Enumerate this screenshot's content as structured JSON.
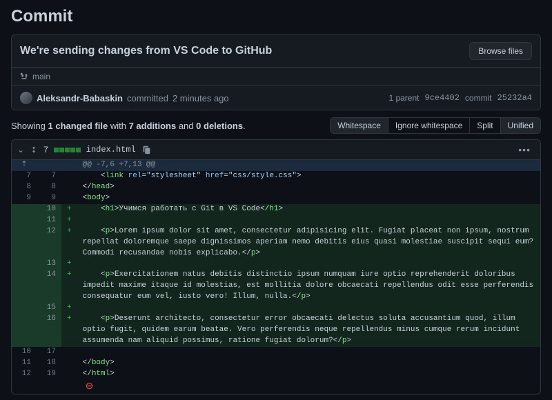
{
  "page": {
    "title": "Commit"
  },
  "commit": {
    "title": "We're sending changes from VS Code to GitHub",
    "browse_btn": "Browse files",
    "branch": "main",
    "author": "Aleksandr-Babaskin",
    "committed_label": "committed",
    "time_ago": "2 minutes ago",
    "parent_label": "1 parent",
    "parent_sha": "9ce4402",
    "commit_label": "commit",
    "commit_sha": "25232a4"
  },
  "summary": {
    "prefix": "Showing",
    "files": "1 changed file",
    "mid": "with",
    "additions": "7 additions",
    "and": "and",
    "deletions": "0 deletions",
    "suffix": "."
  },
  "view": {
    "whitespace": "Whitespace",
    "ignore": "Ignore whitespace",
    "split": "Split",
    "unified": "Unified"
  },
  "diff": {
    "changes_count": "7",
    "filename": "index.html",
    "hunk": "@@ -7,6 +7,13 @@",
    "lines": [
      {
        "type": "ctx",
        "old": "7",
        "new": "7",
        "html": "    <span class='tk-punc'>&lt;</span><span class='tk-tag'>link</span> <span class='tk-attr'>rel</span>=<span class='tk-str'>\"stylesheet\"</span> <span class='tk-attr'>href</span>=<span class='tk-str'>\"css/style.css\"</span><span class='tk-punc'>&gt;</span>"
      },
      {
        "type": "ctx",
        "old": "8",
        "new": "8",
        "html": "<span class='tk-punc'>&lt;/</span><span class='tk-tag'>head</span><span class='tk-punc'>&gt;</span>"
      },
      {
        "type": "ctx",
        "old": "9",
        "new": "9",
        "html": "<span class='tk-punc'>&lt;</span><span class='tk-tag'>body</span><span class='tk-punc'>&gt;</span>"
      },
      {
        "type": "add",
        "old": "",
        "new": "10",
        "html": "    <span class='tk-punc'>&lt;</span><span class='tk-tag'>h1</span><span class='tk-punc'>&gt;</span>Учимся работать с Git в VS Code<span class='tk-punc'>&lt;/</span><span class='tk-tag'>h1</span><span class='tk-punc'>&gt;</span>"
      },
      {
        "type": "add",
        "old": "",
        "new": "11",
        "html": ""
      },
      {
        "type": "add",
        "old": "",
        "new": "12",
        "html": "    <span class='tk-punc'>&lt;</span><span class='tk-tag'>p</span><span class='tk-punc'>&gt;</span>Lorem ipsum dolor sit amet, consectetur adipisicing elit. Fugiat placeat non ipsum, nostrum repellat doloremque saepe dignissimos aperiam nemo debitis eius quasi molestiae suscipit sequi eum? Commodi recusandae nobis explicabo.<span class='tk-punc'>&lt;/</span><span class='tk-tag'>p</span><span class='tk-punc'>&gt;</span>"
      },
      {
        "type": "add",
        "old": "",
        "new": "13",
        "html": ""
      },
      {
        "type": "add",
        "old": "",
        "new": "14",
        "html": "    <span class='tk-punc'>&lt;</span><span class='tk-tag'>p</span><span class='tk-punc'>&gt;</span>Exercitationem natus debitis distinctio ipsum numquam iure optio reprehenderit doloribus impedit maxime itaque id molestias, est mollitia dolore obcaecati repellendus odit esse perferendis consequatur eum vel, iusto vero! Illum, nulla.<span class='tk-punc'>&lt;/</span><span class='tk-tag'>p</span><span class='tk-punc'>&gt;</span>"
      },
      {
        "type": "add",
        "old": "",
        "new": "15",
        "html": ""
      },
      {
        "type": "add",
        "old": "",
        "new": "16",
        "html": "    <span class='tk-punc'>&lt;</span><span class='tk-tag'>p</span><span class='tk-punc'>&gt;</span>Deserunt architecto, consectetur error obcaecati delectus soluta accusantium quod, illum optio fugit, quidem earum beatae. Vero perferendis neque repellendus minus cumque rerum incidunt assumenda nam aliquid possimus, ratione fugiat dolorum?<span class='tk-punc'>&lt;/</span><span class='tk-tag'>p</span><span class='tk-punc'>&gt;</span>"
      },
      {
        "type": "ctx",
        "old": "10",
        "new": "17",
        "html": ""
      },
      {
        "type": "ctx",
        "old": "11",
        "new": "18",
        "html": "<span class='tk-punc'>&lt;/</span><span class='tk-tag'>body</span><span class='tk-punc'>&gt;</span>"
      },
      {
        "type": "ctx",
        "old": "12",
        "new": "19",
        "html": "<span class='tk-punc'>&lt;/</span><span class='tk-tag'>html</span><span class='tk-punc'>&gt;</span>"
      }
    ]
  }
}
